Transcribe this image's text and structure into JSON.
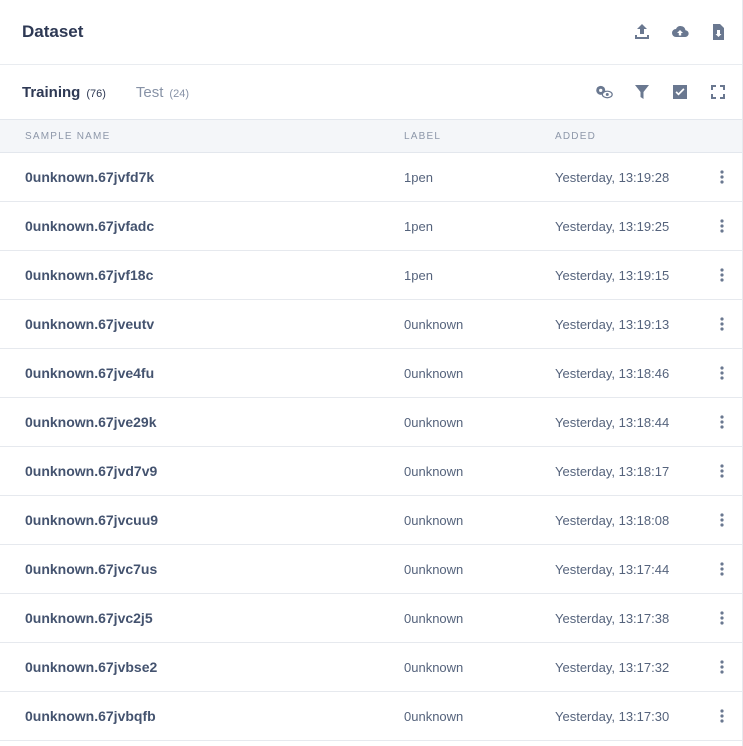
{
  "header": {
    "title": "Dataset",
    "actions": [
      {
        "icon": "upload-icon"
      },
      {
        "icon": "cloud-upload-icon"
      },
      {
        "icon": "file-download-icon"
      }
    ]
  },
  "tabs": [
    {
      "label": "Training",
      "count": "(76)",
      "active": true
    },
    {
      "label": "Test",
      "count": "(24)",
      "active": false
    }
  ],
  "tab_actions": [
    {
      "icon": "settings-view-icon"
    },
    {
      "icon": "filter-icon"
    },
    {
      "icon": "checkbox-icon"
    },
    {
      "icon": "fullscreen-icon"
    }
  ],
  "table": {
    "columns": {
      "name": "Sample name",
      "label": "Label",
      "added": "Added"
    },
    "rows": [
      {
        "name": "0unknown.67jvfd7k",
        "label": "1pen",
        "added": "Yesterday, 13:19:28"
      },
      {
        "name": "0unknown.67jvfadc",
        "label": "1pen",
        "added": "Yesterday, 13:19:25"
      },
      {
        "name": "0unknown.67jvf18c",
        "label": "1pen",
        "added": "Yesterday, 13:19:15"
      },
      {
        "name": "0unknown.67jveutv",
        "label": "0unknown",
        "added": "Yesterday, 13:19:13"
      },
      {
        "name": "0unknown.67jve4fu",
        "label": "0unknown",
        "added": "Yesterday, 13:18:46"
      },
      {
        "name": "0unknown.67jve29k",
        "label": "0unknown",
        "added": "Yesterday, 13:18:44"
      },
      {
        "name": "0unknown.67jvd7v9",
        "label": "0unknown",
        "added": "Yesterday, 13:18:17"
      },
      {
        "name": "0unknown.67jvcuu9",
        "label": "0unknown",
        "added": "Yesterday, 13:18:08"
      },
      {
        "name": "0unknown.67jvc7us",
        "label": "0unknown",
        "added": "Yesterday, 13:17:44"
      },
      {
        "name": "0unknown.67jvc2j5",
        "label": "0unknown",
        "added": "Yesterday, 13:17:38"
      },
      {
        "name": "0unknown.67jvbse2",
        "label": "0unknown",
        "added": "Yesterday, 13:17:32"
      },
      {
        "name": "0unknown.67jvbqfb",
        "label": "0unknown",
        "added": "Yesterday, 13:17:30"
      }
    ]
  },
  "colors": {
    "title": "#2e3954",
    "text": "#44536f",
    "muted": "#8d97a9",
    "header_bg": "#f4f6f9",
    "icon": "#6a7890"
  }
}
